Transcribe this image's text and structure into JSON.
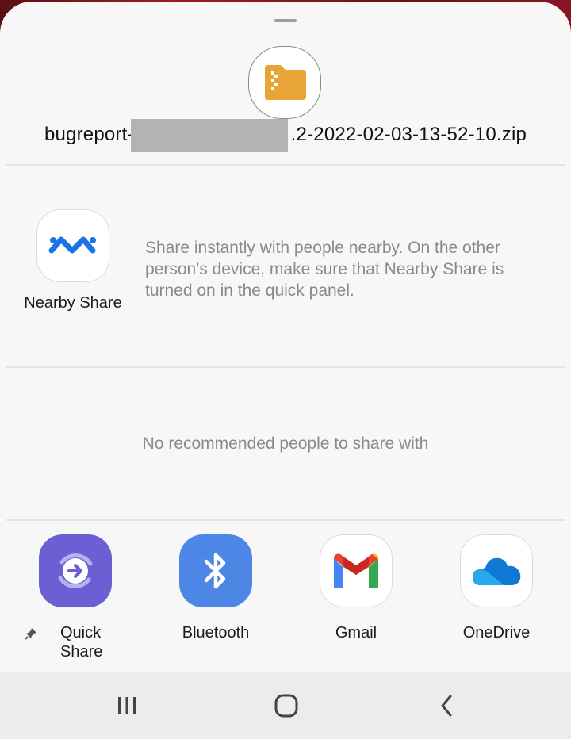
{
  "file": {
    "name_prefix": "bugreport-",
    "name_suffix": ".2-2022-02-03-13-52-10.zip",
    "icon": "folder-icon",
    "icon_color": "#e8a437"
  },
  "nearby": {
    "label": "Nearby Share",
    "description": "Share instantly with people nearby. On the other person's device, make sure that Nearby Share is turned on in the quick panel.",
    "icon": "nearby-share-icon",
    "icon_color": "#1a73e8"
  },
  "people": {
    "empty_message": "No recommended people to share with"
  },
  "apps": [
    {
      "label": "Quick\nShare",
      "icon": "quick-share-icon",
      "color": "#6b5fd3",
      "pinned": true
    },
    {
      "label": "Bluetooth",
      "icon": "bluetooth-icon",
      "color": "#4e86e6"
    },
    {
      "label": "Gmail",
      "icon": "gmail-icon"
    },
    {
      "label": "OneDrive",
      "icon": "onedrive-icon",
      "color": "#0f78d4"
    }
  ],
  "navbar": {
    "buttons": [
      "recent-apps-icon",
      "home-icon",
      "back-icon"
    ]
  }
}
